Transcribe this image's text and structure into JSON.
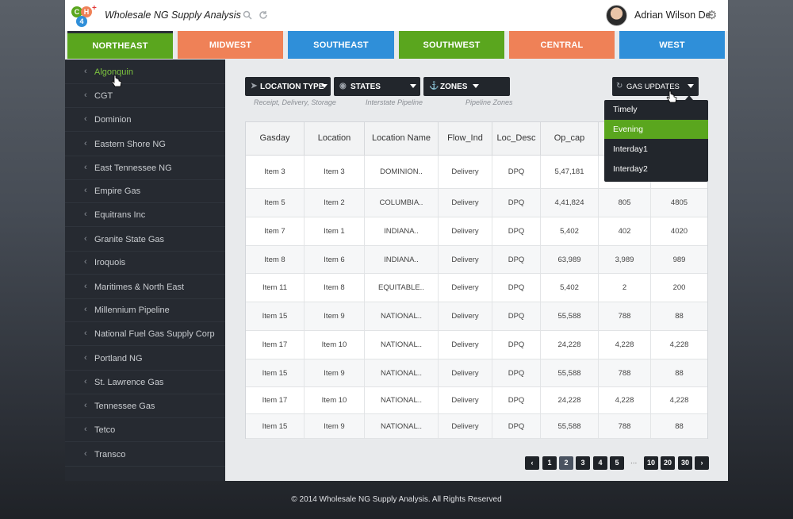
{
  "header": {
    "title": "Wholesale NG Supply Analysis",
    "logo": {
      "c": "C",
      "h": "H",
      "num": "4"
    },
    "user_name": "Adrian Wilson De"
  },
  "tabs": [
    {
      "label": "NORTHEAST",
      "color": "#5aa61e",
      "active": true
    },
    {
      "label": "MIDWEST",
      "color": "#ef8157"
    },
    {
      "label": "SOUTHEAST",
      "color": "#2f8fd9"
    },
    {
      "label": "SOUTHWEST",
      "color": "#5aa61e"
    },
    {
      "label": "CENTRAL",
      "color": "#ef8157"
    },
    {
      "label": "WEST",
      "color": "#2f8fd9"
    }
  ],
  "sidebar": {
    "items": [
      {
        "label": "Algonquin",
        "active": true
      },
      {
        "label": "CGT"
      },
      {
        "label": "Dominion"
      },
      {
        "label": "Eastern Shore NG"
      },
      {
        "label": "East Tennessee NG"
      },
      {
        "label": "Empire Gas"
      },
      {
        "label": "Equitrans Inc"
      },
      {
        "label": "Granite State Gas"
      },
      {
        "label": "Iroquois"
      },
      {
        "label": "Maritimes & North East"
      },
      {
        "label": "Millennium Pipeline"
      },
      {
        "label": "National Fuel Gas Supply Corp"
      },
      {
        "label": "Portland NG"
      },
      {
        "label": "St. Lawrence Gas"
      },
      {
        "label": "Tennessee Gas"
      },
      {
        "label": "Tetco"
      },
      {
        "label": "Transco"
      }
    ]
  },
  "filters": {
    "location_type": {
      "label": "LOCATION TYPE",
      "sub": "Receipt, Delivery, Storage"
    },
    "states": {
      "label": "STATES",
      "sub": "Interstate Pipeline"
    },
    "zones": {
      "label": "ZONES",
      "sub": "Pipeline Zones"
    }
  },
  "gas_updates": {
    "label": "GAS UPDATES",
    "options": [
      "Timely",
      "Evening",
      "Interday1",
      "Interday2"
    ],
    "selected": "Evening"
  },
  "table": {
    "headers": [
      "Gasday",
      "Location",
      "Location Name",
      "Flow_Ind",
      "Loc_Desc",
      "Op_cap",
      "",
      ""
    ],
    "rows": [
      [
        "Item 3",
        "Item 3",
        "DOMINION..",
        "Delivery",
        "DPQ",
        "5,47,181",
        "",
        ""
      ],
      [
        "Item 5",
        "Item 2",
        "COLUMBIA..",
        "Delivery",
        "DPQ",
        "4,41,824",
        "805",
        "4805"
      ],
      [
        "Item 7",
        "Item 1",
        "INDIANA..",
        "Delivery",
        "DPQ",
        "5,402",
        "402",
        "4020"
      ],
      [
        "Item 8",
        "Item 6",
        "INDIANA..",
        "Delivery",
        "DPQ",
        "63,989",
        "3,989",
        "989"
      ],
      [
        "Item 11",
        "Item 8",
        "EQUITABLE..",
        "Delivery",
        "DPQ",
        "5,402",
        "2",
        "200"
      ],
      [
        "Item 15",
        "Item 9",
        "NATIONAL..",
        "Delivery",
        "DPQ",
        "55,588",
        "788",
        "88"
      ],
      [
        "Item 17",
        "Item 10",
        "NATIONAL..",
        "Delivery",
        "DPQ",
        "24,228",
        "4,228",
        "4,228"
      ],
      [
        "Item 15",
        "Item 9",
        "NATIONAL..",
        "Delivery",
        "DPQ",
        "55,588",
        "788",
        "88"
      ],
      [
        "Item 17",
        "Item 10",
        "NATIONAL..",
        "Delivery",
        "DPQ",
        "24,228",
        "4,228",
        "4,228"
      ],
      [
        "Item 15",
        "Item 9",
        "NATIONAL..",
        "Delivery",
        "DPQ",
        "55,588",
        "788",
        "88"
      ]
    ]
  },
  "pagination": {
    "prev": "‹",
    "pages": [
      "1",
      "2",
      "3",
      "4",
      "5"
    ],
    "ellipsis": "...",
    "last_pages": [
      "10",
      "20",
      "30"
    ],
    "next": "›",
    "current": "2"
  },
  "footer": {
    "text": "© 2014 Wholesale NG Supply Analysis. All Rights Reserved"
  }
}
